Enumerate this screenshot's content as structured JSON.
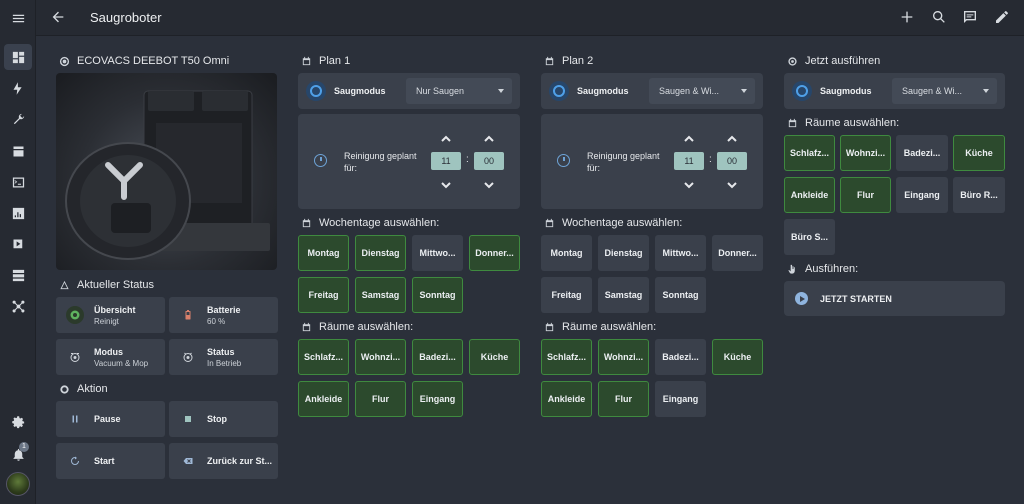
{
  "header": {
    "title": "Saugroboter"
  },
  "sidebar": {
    "notification_count": "1"
  },
  "device": {
    "name": "ECOVACS DEEBOT T50 Omni"
  },
  "status": {
    "heading": "Aktueller Status",
    "tiles": [
      {
        "label": "Übersicht",
        "value": "Reinigt",
        "icon": "robot-icon"
      },
      {
        "label": "Batterie",
        "value": "60 %",
        "icon": "battery-icon"
      },
      {
        "label": "Modus",
        "value": "Vacuum & Mop",
        "icon": "robot-mode-icon"
      },
      {
        "label": "Status",
        "value": "In Betrieb",
        "icon": "robot-status-icon"
      }
    ]
  },
  "action": {
    "heading": "Aktion",
    "buttons": [
      {
        "label": "Pause",
        "icon": "pause-icon"
      },
      {
        "label": "Stop",
        "icon": "stop-icon"
      },
      {
        "label": "Start",
        "icon": "play-icon"
      },
      {
        "label": "Zurück zur St...",
        "icon": "dock-icon"
      }
    ]
  },
  "plan1": {
    "title": "Plan 1",
    "mode_label": "Saugmodus",
    "mode_value": "Nur Saugen",
    "schedule_label": "Reinigung geplant für:",
    "hour": "11",
    "minute": "00",
    "weekdays_heading": "Wochentage auswählen:",
    "weekdays": [
      "Montag",
      "Dienstag",
      "Mittwo...",
      "Donner...",
      "Freitag",
      "Samstag",
      "Sonntag"
    ],
    "rooms_heading": "Räume auswählen:",
    "rooms": [
      "Schlafz...",
      "Wohnzi...",
      "Badezi...",
      "Küche",
      "Ankleide",
      "Flur",
      "Eingang"
    ]
  },
  "plan2": {
    "title": "Plan 2",
    "mode_label": "Saugmodus",
    "mode_value": "Saugen & Wi...",
    "schedule_label": "Reinigung geplant für:",
    "hour": "11",
    "minute": "00",
    "weekdays_heading": "Wochentage auswählen:",
    "weekdays": [
      "Montag",
      "Dienstag",
      "Mittwo...",
      "Donner...",
      "Freitag",
      "Samstag",
      "Sonntag"
    ],
    "rooms_heading": "Räume auswählen:",
    "rooms": [
      "Schlafz...",
      "Wohnzi...",
      "Badezi...",
      "Küche",
      "Ankleide",
      "Flur",
      "Eingang"
    ]
  },
  "now": {
    "title": "Jetzt ausführen",
    "mode_label": "Saugmodus",
    "mode_value": "Saugen & Wi...",
    "rooms_heading": "Räume auswählen:",
    "rooms": [
      "Schlafz...",
      "Wohnzi...",
      "Badezi...",
      "Küche",
      "Ankleide",
      "Flur",
      "Eingang",
      "Büro R...",
      "Büro S..."
    ],
    "execute_heading": "Ausführen:",
    "start_label": "JETZT STARTEN"
  },
  "colors": {
    "selected_bg": "#2c4a2d",
    "selected_border": "#3f8a3f",
    "tile_bg": "#3a404b",
    "page_bg": "#2b303a",
    "accent_blue": "#4fa0e8"
  }
}
